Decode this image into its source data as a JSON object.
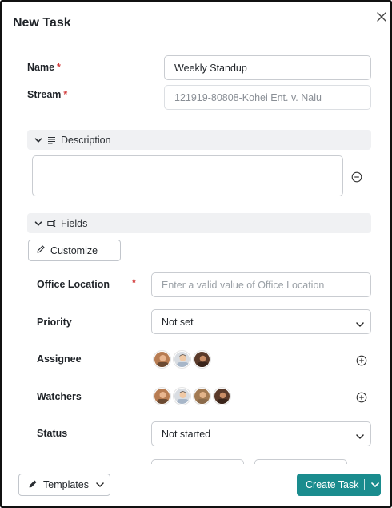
{
  "dialog": {
    "title": "New Task"
  },
  "form": {
    "name": {
      "label": "Name",
      "required": "*",
      "value": "Weekly Standup"
    },
    "stream": {
      "label": "Stream",
      "required": "*",
      "value": "121919-80808-Kohei Ent. v. Nalu"
    }
  },
  "description": {
    "label": "Description"
  },
  "fields": {
    "label": "Fields",
    "customize_label": "Customize",
    "office_location": {
      "label": "Office Location",
      "required": "*",
      "placeholder": "Enter a valid value of Office Location"
    },
    "priority": {
      "label": "Priority",
      "value": "Not set"
    },
    "assignee": {
      "label": "Assignee",
      "avatars": [
        "user-avatar-1",
        "user-avatar-2",
        "user-avatar-3"
      ]
    },
    "watchers": {
      "label": "Watchers",
      "avatars": [
        "user-avatar-1",
        "user-avatar-2",
        "user-avatar-4",
        "user-avatar-3"
      ]
    },
    "status": {
      "label": "Status",
      "value": "Not started"
    }
  },
  "footer": {
    "templates_label": "Templates",
    "create_label": "Create Task"
  },
  "colors": {
    "accent": "#1a8c8e",
    "required": "#d23b3b",
    "section_bg": "#f0f1f3"
  }
}
